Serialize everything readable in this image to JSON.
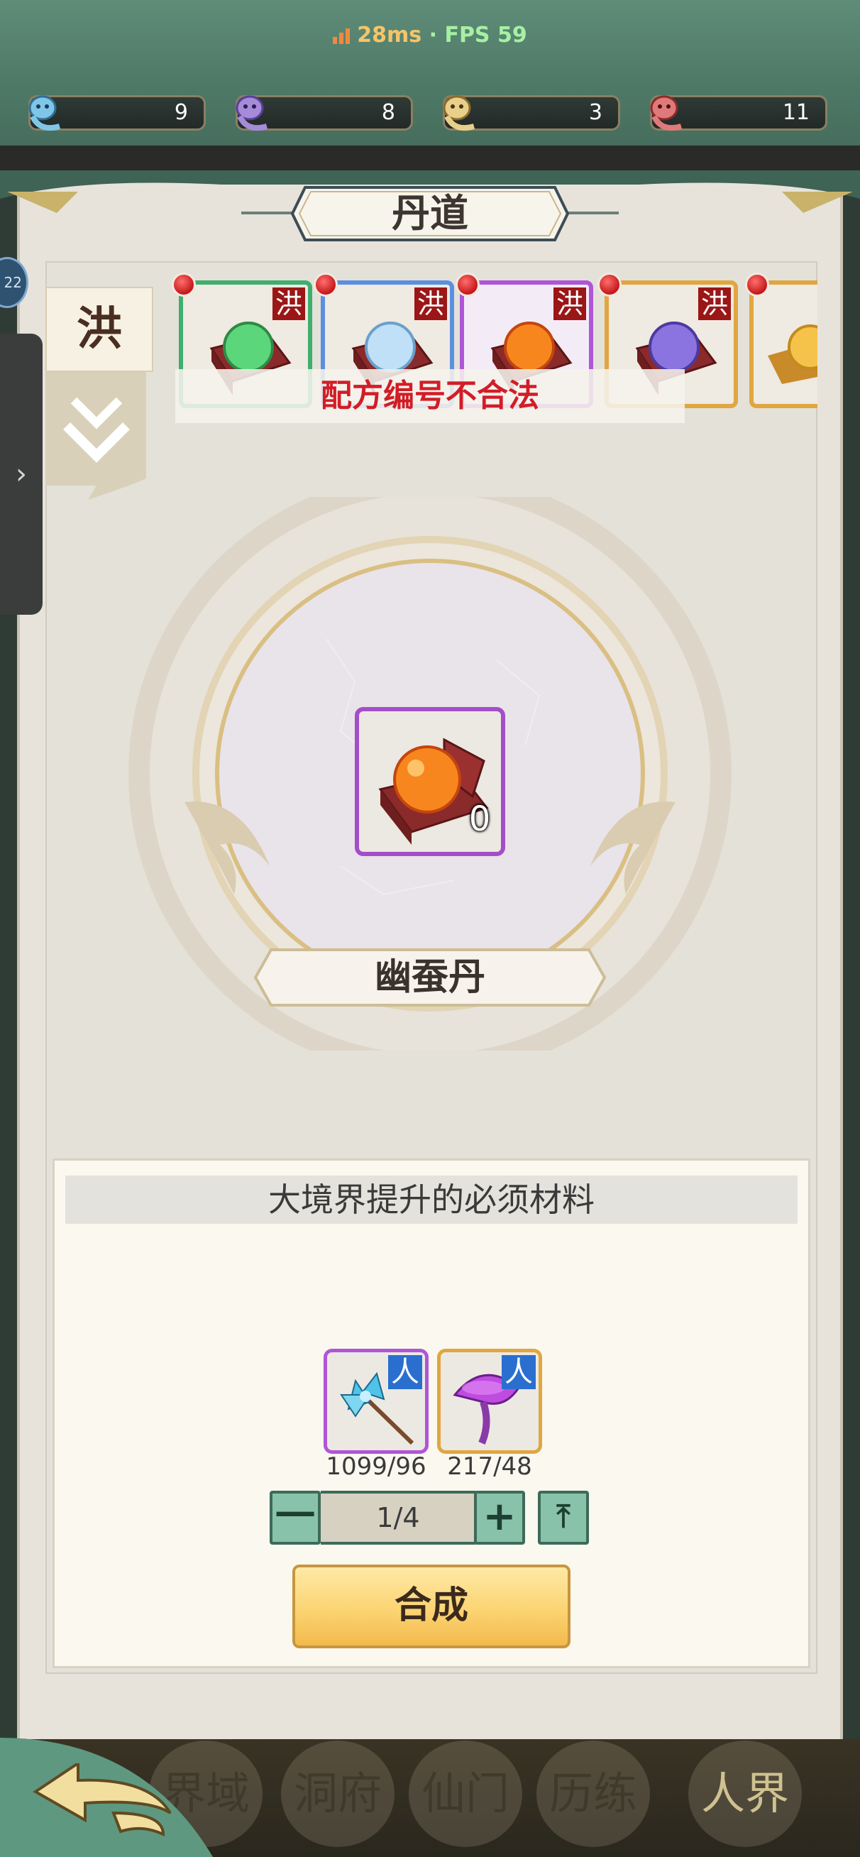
{
  "status": {
    "ping": "28ms",
    "separator": "·",
    "fps": "FPS 59"
  },
  "resources": [
    {
      "icon": "blue-spirit-creature-icon",
      "value": "9"
    },
    {
      "icon": "purple-spirit-creature-icon",
      "value": "8"
    },
    {
      "icon": "yellow-spirit-creature-icon",
      "value": "3"
    },
    {
      "icon": "red-spirit-creature-icon",
      "value": "11"
    }
  ],
  "side_badge": "22",
  "left_drawer_arrow": "›",
  "title": "丹道",
  "side_tab": {
    "label": "洪"
  },
  "recipes": [
    {
      "tag": "洪",
      "orb": "green",
      "frame": "#3fae6e"
    },
    {
      "tag": "洪",
      "orb": "light-blue",
      "frame": "#5b8fe0"
    },
    {
      "tag": "洪",
      "orb": "orange",
      "frame": "#b055d8"
    },
    {
      "tag": "洪",
      "orb": "purple",
      "frame": "#e0a640"
    },
    {
      "tag": "",
      "orb": "gold",
      "frame": "#e0a640"
    }
  ],
  "error_message": "配方编号不合法",
  "pill": {
    "name": "幽蚕丹",
    "count": "0"
  },
  "materials": {
    "header": "大境界提升的必须材料",
    "items": [
      {
        "icon": "blue-flower-herb-icon",
        "tag": "人",
        "count": "1099/96",
        "frame": "#b055d8"
      },
      {
        "icon": "purple-mushroom-icon",
        "tag": "人",
        "count": "217/48",
        "frame": "#e0a640"
      }
    ]
  },
  "stepper": {
    "minus": "一",
    "value": "1/4",
    "plus": "+",
    "max": "⤒"
  },
  "synthesize_button": "合成",
  "bottom_nav": [
    "界域",
    "洞府",
    "仙门",
    "历练",
    "人界"
  ],
  "colors": {
    "accent_gold": "#f3b94b",
    "error_red": "#d21d27",
    "panel": "#e7e3da"
  }
}
